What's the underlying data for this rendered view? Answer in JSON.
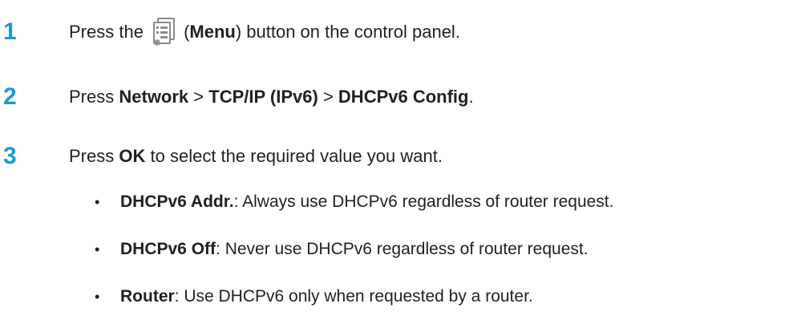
{
  "steps": [
    {
      "number": "1",
      "prefix": "Press the",
      "icon": "menu-icon",
      "paren_open": "(",
      "menu_label": "Menu",
      "paren_close_suffix": ") button on the control panel."
    },
    {
      "number": "2",
      "prefix": "Press",
      "item1": "Network",
      "sep1": ">",
      "item2": "TCP/IP (IPv6)",
      "sep2": ">",
      "item3": "DHCPv6 Config",
      "suffix": "."
    },
    {
      "number": "3",
      "prefix": "Press",
      "ok_label": "OK",
      "suffix": "to select the required value you want."
    }
  ],
  "bullet_symbol": "•",
  "options": [
    {
      "name": "DHCPv6 Addr.",
      "description": ": Always use DHCPv6 regardless of router request."
    },
    {
      "name": "DHCPv6 Off",
      "description": ": Never use DHCPv6 regardless of router request."
    },
    {
      "name": "Router",
      "description": ": Use DHCPv6 only when requested by a router."
    }
  ],
  "colors": {
    "step_number": "#1a9ad6",
    "text": "#231f20",
    "icon_gray": "#8a8c8e"
  }
}
